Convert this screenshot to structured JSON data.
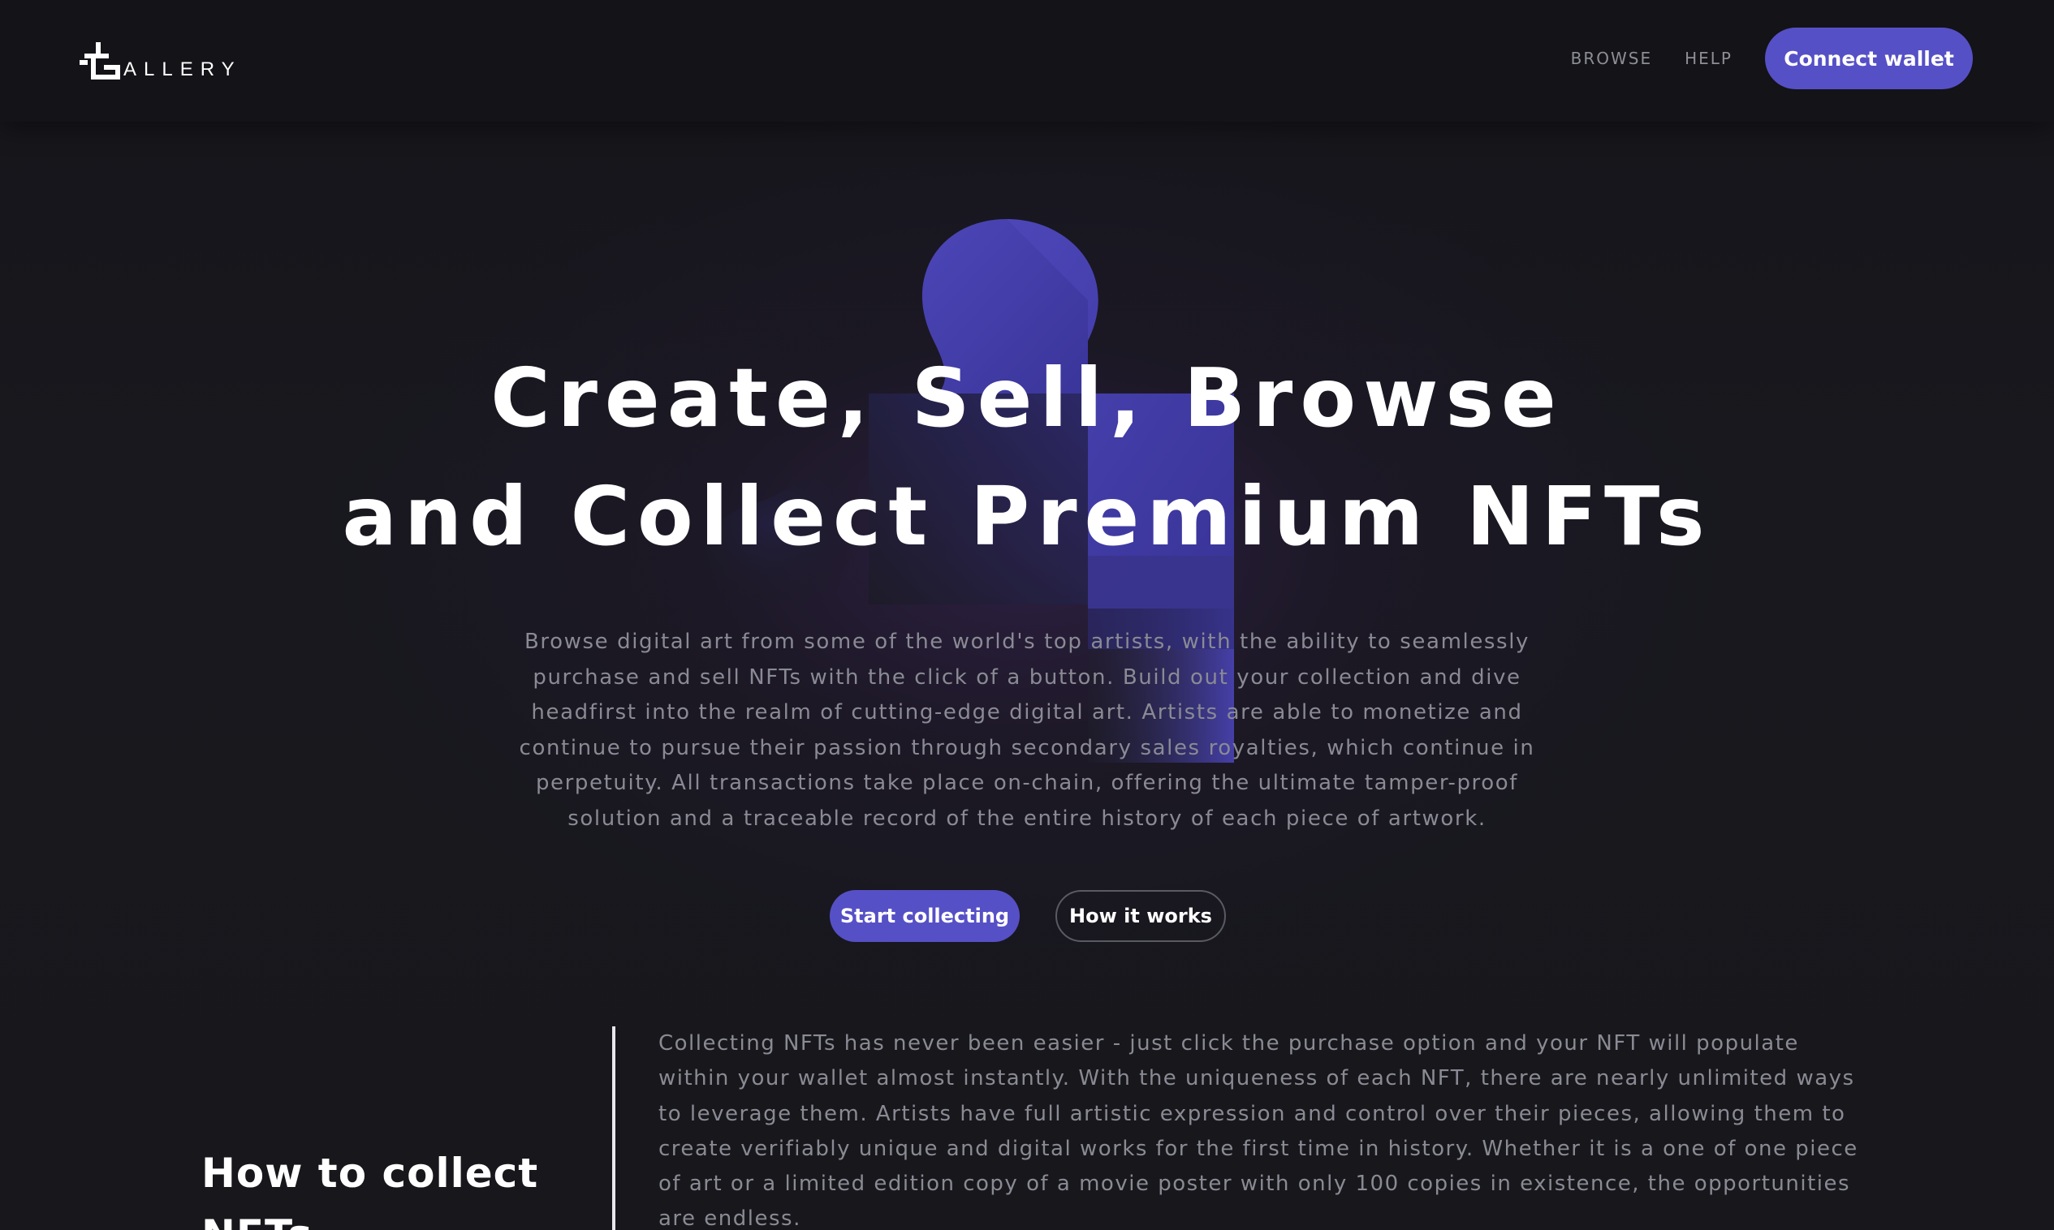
{
  "header": {
    "logo_text": "ALLERY",
    "nav": {
      "browse": "BROWSE",
      "help": "HELP"
    },
    "connect_wallet": "Connect wallet"
  },
  "hero": {
    "title_line1": "Create, Sell, Browse",
    "title_line2": "and Collect Premium NFTs",
    "description": "Browse digital art from some of the world's top artists, with the ability to seamlessly purchase and sell NFTs with the click of a button. Build out your collection and dive headfirst into the realm of cutting-edge digital art. Artists are able to monetize and continue to pursue their passion through secondary sales royalties, which continue in perpetuity. All transactions take place on-chain, offering the ultimate tamper-proof solution and a traceable record of the entire history of each piece of artwork.",
    "primary_cta": "Start collecting",
    "secondary_cta": "How it works",
    "art_icon": "puzzle-piece-icon"
  },
  "how_to_collect": {
    "title": "How to collect NFTs",
    "body": "Collecting NFTs has never been easier - just click the purchase option and your NFT will populate within your wallet almost instantly. With the uniqueness of each NFT, there are nearly unlimited ways to leverage them. Artists have full artistic expression and control over their pieces, allowing them to create verifiably unique and digital works for the first time in history. Whether it is a one of one piece of art or a limited edition copy of a movie poster with only 100 copies in existence, the opportunities are endless."
  },
  "colors": {
    "accent": "#5650c6",
    "background": "#15151a",
    "muted_text": "#8a8a94"
  }
}
